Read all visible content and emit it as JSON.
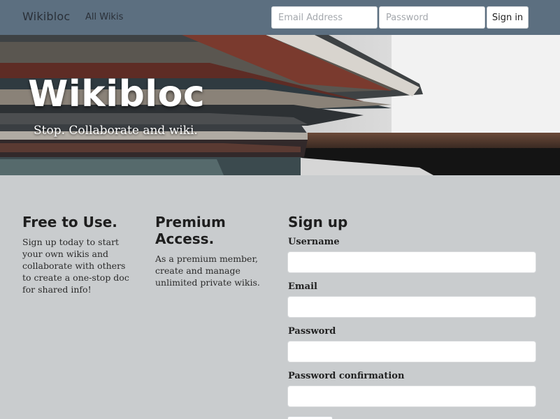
{
  "navbar": {
    "brand": "Wikibloc",
    "all_wikis_link": "All Wikis",
    "email_placeholder": "Email Address",
    "password_placeholder": "Password",
    "signin_label": "Sign in"
  },
  "hero": {
    "title": "Wikibloc",
    "tagline": "Stop. Collaborate and wiki."
  },
  "features": {
    "free": {
      "title": "Free to Use.",
      "text": "Sign up today to start your own wikis and collaborate with others to create a one-stop doc for shared info!"
    },
    "premium": {
      "title": "Premium Access.",
      "text": "As a premium member, create and manage unlimited private wikis."
    }
  },
  "signup": {
    "title": "Sign up",
    "username_label": "Username",
    "email_label": "Email",
    "password_label": "Password",
    "password_confirmation_label": "Password confirmation"
  },
  "colors": {
    "navbar_bg": "#5c6f80",
    "page_bg": "#c9ccce"
  }
}
